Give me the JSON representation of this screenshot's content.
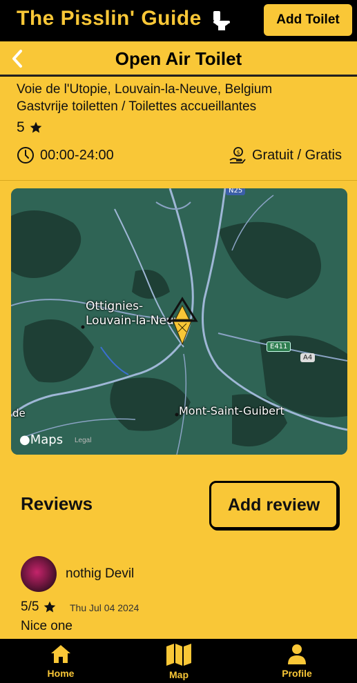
{
  "header": {
    "app_title": "The  Pisslin'  Guide",
    "add_toilet_label": "Add Toilet"
  },
  "nav": {
    "title": "Open Air Toilet"
  },
  "toilet": {
    "address": "Voie de l'Utopie, Louvain-la-Neuve, Belgium",
    "description": "Gastvrije toiletten / Toilettes accueillantes",
    "rating": "5",
    "hours": "00:00-24:00",
    "fee": "Gratuit / Gratis"
  },
  "map": {
    "city_line1": "Ottignies-",
    "city_line2": "Louvain-la-Neuve",
    "town": "Mont-Saint-Guibert",
    "edge_label": "de",
    "road_e411": "E411",
    "road_a4": "A4",
    "road_top": "N25",
    "logo": "Maps",
    "legal": "Legal",
    "colors": {
      "land": "#2f6455",
      "dark_forest": "#1e3f35",
      "road": "#9fb7d6"
    }
  },
  "reviews": {
    "title": "Reviews",
    "add_label": "Add review",
    "items": [
      {
        "user": "nothig Devil",
        "rating": "5/5",
        "date": "Thu Jul 04 2024",
        "text": "Nice one"
      }
    ]
  },
  "tabs": [
    {
      "label": "Home",
      "icon": "home-icon"
    },
    {
      "label": "Map",
      "icon": "map-icon"
    },
    {
      "label": "Profile",
      "icon": "profile-icon"
    }
  ],
  "colors": {
    "accent": "#F9C737",
    "background": "#000000"
  }
}
